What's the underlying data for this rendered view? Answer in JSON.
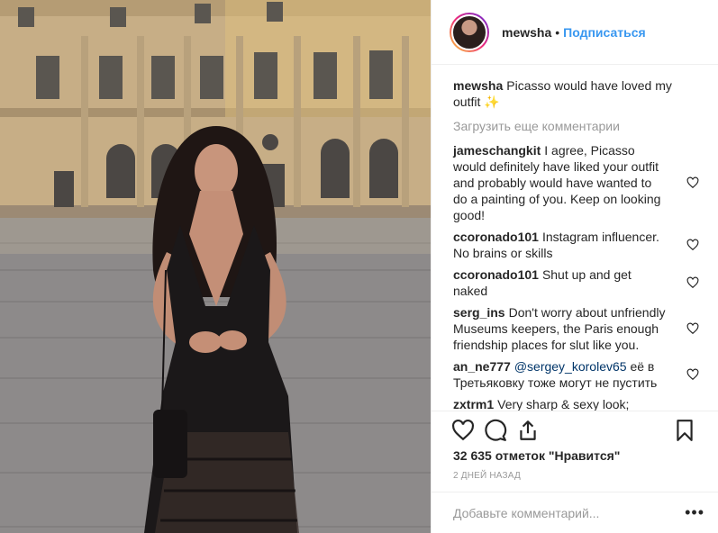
{
  "post": {
    "username": "mewsha",
    "separator": "•",
    "follow_label": "Подписаться",
    "caption_user": "mewsha",
    "caption_text": "Picasso would have loved my outfit ✨",
    "load_more": "Загрузить еще комментарии"
  },
  "comments": [
    {
      "user": "jameschangkit",
      "text": "I agree, Picasso would definitely have liked your outfit and probably would have wanted to do a painting of you. Keep on looking good!"
    },
    {
      "user": "ccoronado101",
      "text": "Instagram influencer. No brains or skills"
    },
    {
      "user": "ccoronado101",
      "text": "Shut up and get naked"
    },
    {
      "user": "serg_ins",
      "text": "Don't worry about unfriendly Museums keepers, the Paris enough friendship places for slut like you."
    },
    {
      "user": "an_ne777",
      "mention": "@sergey_korolev65",
      "text": "её в Третьяковку тоже могут не пустить"
    },
    {
      "user": "zxtrm1",
      "text": "Very sharp & sexy look; entirely acceptable in this day & age,"
    }
  ],
  "footer": {
    "likes": "32 635 отметок \"Нравится\"",
    "date": "2 дней назад",
    "add_placeholder": "Добавьте комментарий...",
    "more": "•••"
  },
  "icons": {
    "like": "heart-icon",
    "comment": "comment-icon",
    "share": "share-icon",
    "save": "bookmark-icon"
  }
}
